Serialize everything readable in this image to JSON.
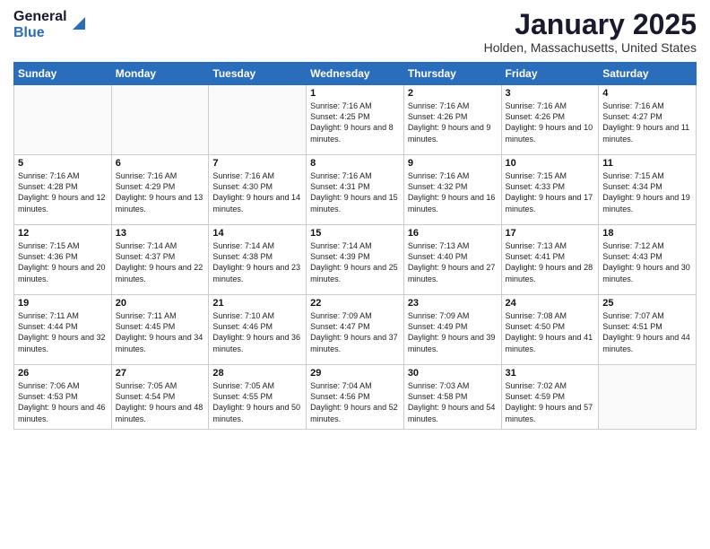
{
  "header": {
    "logo_general": "General",
    "logo_blue": "Blue",
    "month_title": "January 2025",
    "location": "Holden, Massachusetts, United States"
  },
  "weekdays": [
    "Sunday",
    "Monday",
    "Tuesday",
    "Wednesday",
    "Thursday",
    "Friday",
    "Saturday"
  ],
  "weeks": [
    [
      {
        "day": "",
        "sunrise": "",
        "sunset": "",
        "daylight": ""
      },
      {
        "day": "",
        "sunrise": "",
        "sunset": "",
        "daylight": ""
      },
      {
        "day": "",
        "sunrise": "",
        "sunset": "",
        "daylight": ""
      },
      {
        "day": "1",
        "sunrise": "Sunrise: 7:16 AM",
        "sunset": "Sunset: 4:25 PM",
        "daylight": "Daylight: 9 hours and 8 minutes."
      },
      {
        "day": "2",
        "sunrise": "Sunrise: 7:16 AM",
        "sunset": "Sunset: 4:26 PM",
        "daylight": "Daylight: 9 hours and 9 minutes."
      },
      {
        "day": "3",
        "sunrise": "Sunrise: 7:16 AM",
        "sunset": "Sunset: 4:26 PM",
        "daylight": "Daylight: 9 hours and 10 minutes."
      },
      {
        "day": "4",
        "sunrise": "Sunrise: 7:16 AM",
        "sunset": "Sunset: 4:27 PM",
        "daylight": "Daylight: 9 hours and 11 minutes."
      }
    ],
    [
      {
        "day": "5",
        "sunrise": "Sunrise: 7:16 AM",
        "sunset": "Sunset: 4:28 PM",
        "daylight": "Daylight: 9 hours and 12 minutes."
      },
      {
        "day": "6",
        "sunrise": "Sunrise: 7:16 AM",
        "sunset": "Sunset: 4:29 PM",
        "daylight": "Daylight: 9 hours and 13 minutes."
      },
      {
        "day": "7",
        "sunrise": "Sunrise: 7:16 AM",
        "sunset": "Sunset: 4:30 PM",
        "daylight": "Daylight: 9 hours and 14 minutes."
      },
      {
        "day": "8",
        "sunrise": "Sunrise: 7:16 AM",
        "sunset": "Sunset: 4:31 PM",
        "daylight": "Daylight: 9 hours and 15 minutes."
      },
      {
        "day": "9",
        "sunrise": "Sunrise: 7:16 AM",
        "sunset": "Sunset: 4:32 PM",
        "daylight": "Daylight: 9 hours and 16 minutes."
      },
      {
        "day": "10",
        "sunrise": "Sunrise: 7:15 AM",
        "sunset": "Sunset: 4:33 PM",
        "daylight": "Daylight: 9 hours and 17 minutes."
      },
      {
        "day": "11",
        "sunrise": "Sunrise: 7:15 AM",
        "sunset": "Sunset: 4:34 PM",
        "daylight": "Daylight: 9 hours and 19 minutes."
      }
    ],
    [
      {
        "day": "12",
        "sunrise": "Sunrise: 7:15 AM",
        "sunset": "Sunset: 4:36 PM",
        "daylight": "Daylight: 9 hours and 20 minutes."
      },
      {
        "day": "13",
        "sunrise": "Sunrise: 7:14 AM",
        "sunset": "Sunset: 4:37 PM",
        "daylight": "Daylight: 9 hours and 22 minutes."
      },
      {
        "day": "14",
        "sunrise": "Sunrise: 7:14 AM",
        "sunset": "Sunset: 4:38 PM",
        "daylight": "Daylight: 9 hours and 23 minutes."
      },
      {
        "day": "15",
        "sunrise": "Sunrise: 7:14 AM",
        "sunset": "Sunset: 4:39 PM",
        "daylight": "Daylight: 9 hours and 25 minutes."
      },
      {
        "day": "16",
        "sunrise": "Sunrise: 7:13 AM",
        "sunset": "Sunset: 4:40 PM",
        "daylight": "Daylight: 9 hours and 27 minutes."
      },
      {
        "day": "17",
        "sunrise": "Sunrise: 7:13 AM",
        "sunset": "Sunset: 4:41 PM",
        "daylight": "Daylight: 9 hours and 28 minutes."
      },
      {
        "day": "18",
        "sunrise": "Sunrise: 7:12 AM",
        "sunset": "Sunset: 4:43 PM",
        "daylight": "Daylight: 9 hours and 30 minutes."
      }
    ],
    [
      {
        "day": "19",
        "sunrise": "Sunrise: 7:11 AM",
        "sunset": "Sunset: 4:44 PM",
        "daylight": "Daylight: 9 hours and 32 minutes."
      },
      {
        "day": "20",
        "sunrise": "Sunrise: 7:11 AM",
        "sunset": "Sunset: 4:45 PM",
        "daylight": "Daylight: 9 hours and 34 minutes."
      },
      {
        "day": "21",
        "sunrise": "Sunrise: 7:10 AM",
        "sunset": "Sunset: 4:46 PM",
        "daylight": "Daylight: 9 hours and 36 minutes."
      },
      {
        "day": "22",
        "sunrise": "Sunrise: 7:09 AM",
        "sunset": "Sunset: 4:47 PM",
        "daylight": "Daylight: 9 hours and 37 minutes."
      },
      {
        "day": "23",
        "sunrise": "Sunrise: 7:09 AM",
        "sunset": "Sunset: 4:49 PM",
        "daylight": "Daylight: 9 hours and 39 minutes."
      },
      {
        "day": "24",
        "sunrise": "Sunrise: 7:08 AM",
        "sunset": "Sunset: 4:50 PM",
        "daylight": "Daylight: 9 hours and 41 minutes."
      },
      {
        "day": "25",
        "sunrise": "Sunrise: 7:07 AM",
        "sunset": "Sunset: 4:51 PM",
        "daylight": "Daylight: 9 hours and 44 minutes."
      }
    ],
    [
      {
        "day": "26",
        "sunrise": "Sunrise: 7:06 AM",
        "sunset": "Sunset: 4:53 PM",
        "daylight": "Daylight: 9 hours and 46 minutes."
      },
      {
        "day": "27",
        "sunrise": "Sunrise: 7:05 AM",
        "sunset": "Sunset: 4:54 PM",
        "daylight": "Daylight: 9 hours and 48 minutes."
      },
      {
        "day": "28",
        "sunrise": "Sunrise: 7:05 AM",
        "sunset": "Sunset: 4:55 PM",
        "daylight": "Daylight: 9 hours and 50 minutes."
      },
      {
        "day": "29",
        "sunrise": "Sunrise: 7:04 AM",
        "sunset": "Sunset: 4:56 PM",
        "daylight": "Daylight: 9 hours and 52 minutes."
      },
      {
        "day": "30",
        "sunrise": "Sunrise: 7:03 AM",
        "sunset": "Sunset: 4:58 PM",
        "daylight": "Daylight: 9 hours and 54 minutes."
      },
      {
        "day": "31",
        "sunrise": "Sunrise: 7:02 AM",
        "sunset": "Sunset: 4:59 PM",
        "daylight": "Daylight: 9 hours and 57 minutes."
      },
      {
        "day": "",
        "sunrise": "",
        "sunset": "",
        "daylight": ""
      }
    ]
  ]
}
